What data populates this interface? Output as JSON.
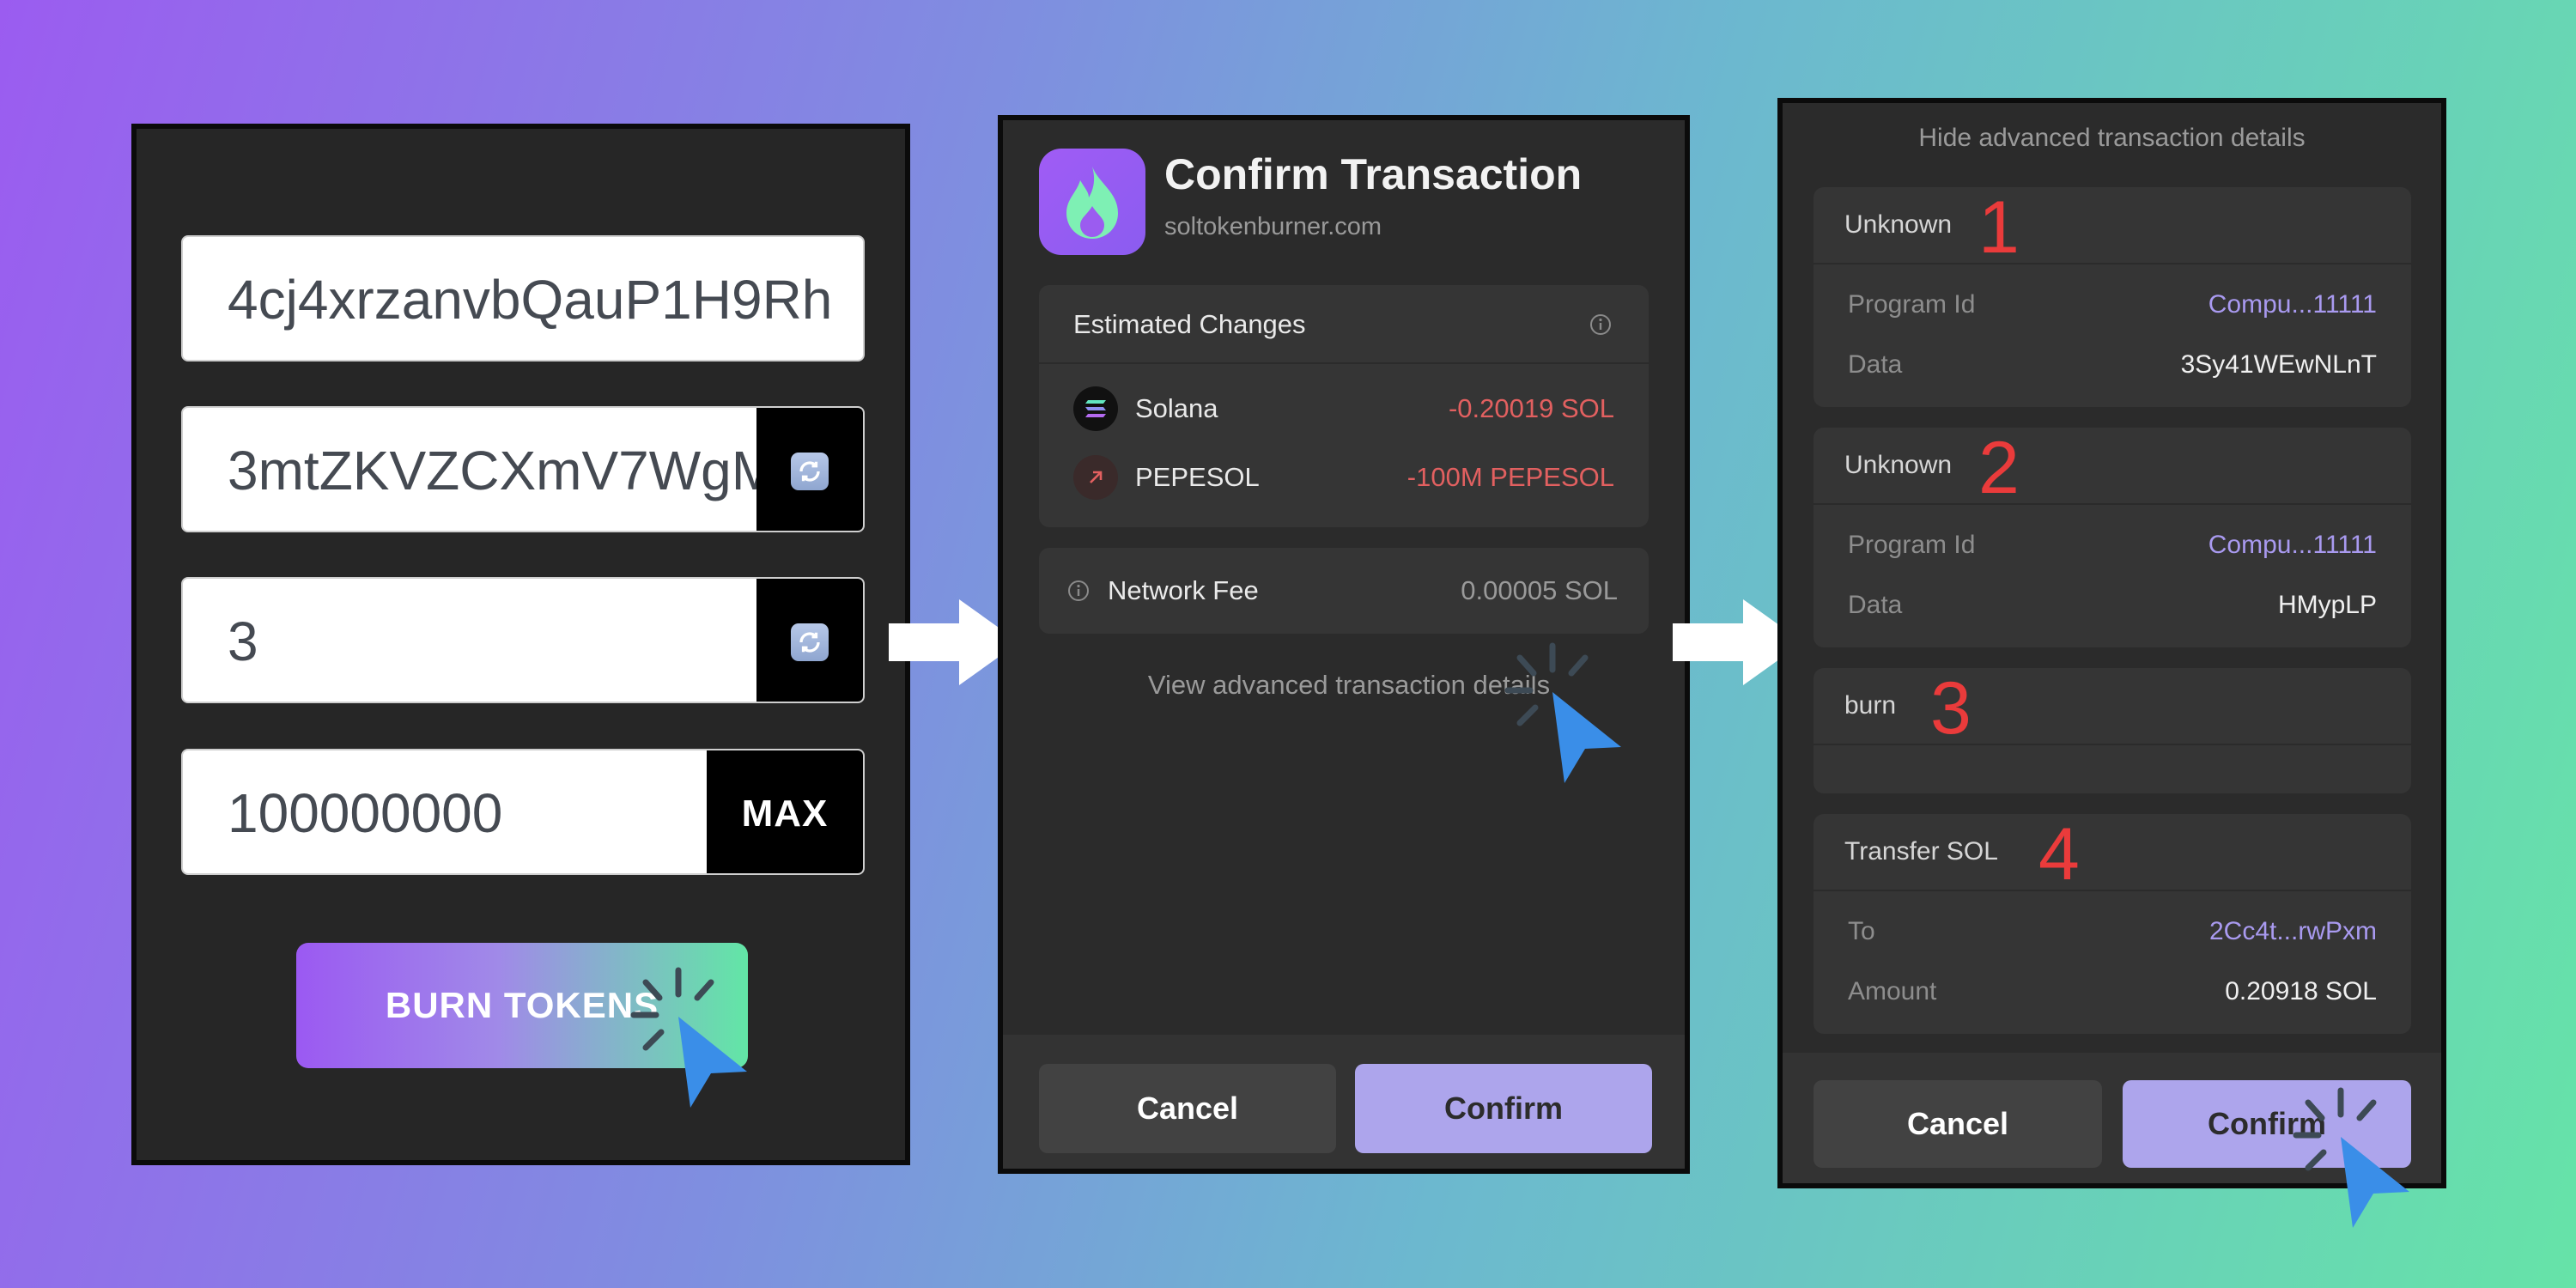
{
  "panel1": {
    "mint_address": "4cj4xrzanvbQauP1H9Rh",
    "token_account": "3mtZKVZCXmV7WgM",
    "decimals": "3",
    "amount": "100000000",
    "max_label": "MAX",
    "burn_button": "BURN TOKENS"
  },
  "panel2": {
    "title": "Confirm Transaction",
    "domain": "soltokenburner.com",
    "estimated_changes_label": "Estimated Changes",
    "changes": [
      {
        "name": "Solana",
        "amount": "-0.20019 SOL"
      },
      {
        "name": "PEPESOL",
        "amount": "-100M PEPESOL"
      }
    ],
    "network_fee_label": "Network Fee",
    "network_fee_value": "0.00005 SOL",
    "advanced_link": "View advanced transaction details",
    "cancel": "Cancel",
    "confirm": "Confirm"
  },
  "panel3": {
    "hide_link": "Hide advanced transaction details",
    "instructions": [
      {
        "title": "Unknown",
        "marker": "1",
        "rows": [
          {
            "label": "Program Id",
            "value": "Compu...11111"
          },
          {
            "label": "Data",
            "value": "3Sy41WEwNLnT"
          }
        ]
      },
      {
        "title": "Unknown",
        "marker": "2",
        "rows": [
          {
            "label": "Program Id",
            "value": "Compu...11111"
          },
          {
            "label": "Data",
            "value": "HMypLP"
          }
        ]
      },
      {
        "title": "burn",
        "marker": "3",
        "rows": []
      },
      {
        "title": "Transfer SOL",
        "marker": "4",
        "rows": [
          {
            "label": "To",
            "value": "2Cc4t...rwPxm"
          },
          {
            "label": "Amount",
            "value": "0.20918 SOL"
          }
        ]
      }
    ],
    "cancel": "Cancel",
    "confirm": "Confirm"
  },
  "colors": {
    "accent_purple": "#ada5ec",
    "negative_red": "#e26060",
    "link_purple": "#a99af0",
    "annotation_red": "#ea3b3b",
    "cursor_blue": "#3a8ee8"
  },
  "icons": [
    "refresh-icon",
    "flame-icon",
    "solana-icon",
    "arrow-up-right-icon",
    "info-icon",
    "cursor-click-icon",
    "right-arrow-icon"
  ]
}
